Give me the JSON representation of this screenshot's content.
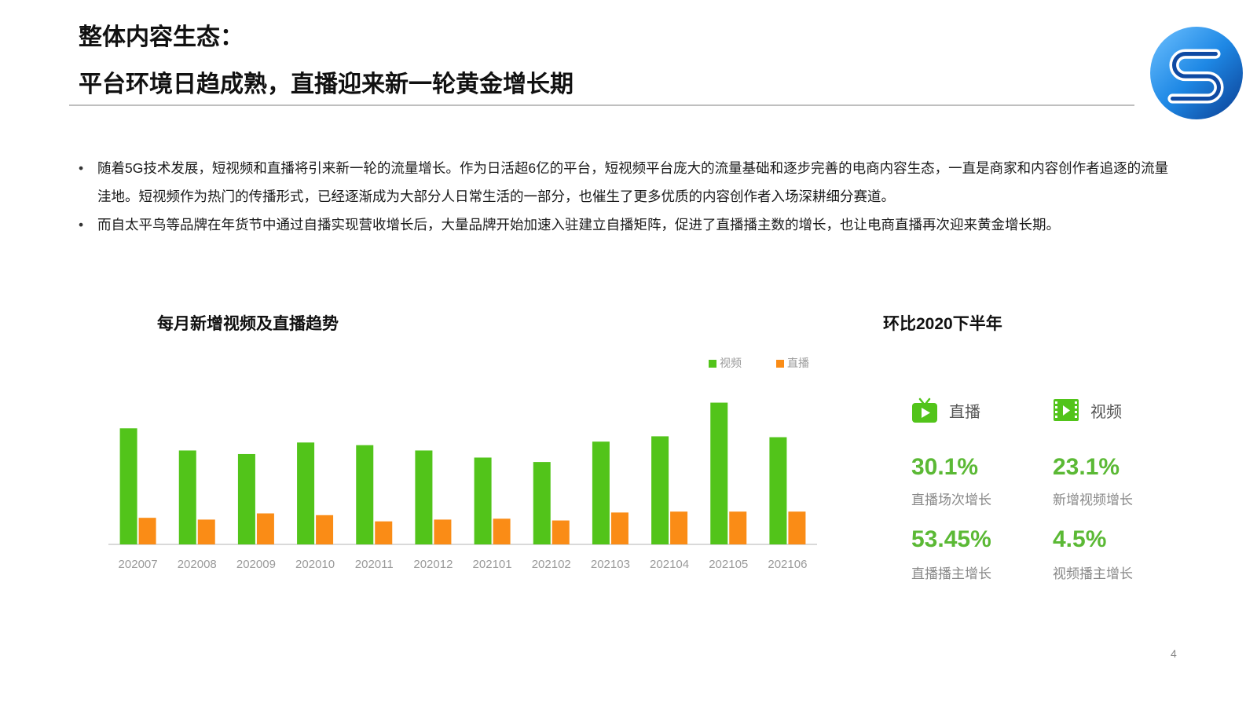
{
  "header": {
    "title_line1": "整体内容生态：",
    "title_line2": "平台环境日趋成熟，直播迎来新一轮黄金增长期"
  },
  "bullets": [
    "随着5G技术发展，短视频和直播将引来新一轮的流量增长。作为日活超6亿的平台，短视频平台庞大的流量基础和逐步完善的电商内容生态，一直是商家和内容创作者追逐的流量洼地。短视频作为热门的传播形式，已经逐渐成为大部分人日常生活的一部分，也催生了更多优质的内容创作者入场深耕细分赛道。",
    "而自太平鸟等品牌在年货节中通过自播实现营收增长后，大量品牌开始加速入驻建立自播矩阵，促进了直播播主数的增长，也让电商直播再次迎来黄金增长期。"
  ],
  "chart_data": {
    "type": "bar",
    "title": "每月新增视频及直播趋势",
    "categories": [
      "202007",
      "202008",
      "202009",
      "202010",
      "202011",
      "202012",
      "202101",
      "202102",
      "202103",
      "202104",
      "202105",
      "202106"
    ],
    "series": [
      {
        "name": "视频",
        "color": "#52c41a",
        "values": [
          131,
          106,
          102,
          115,
          112,
          106,
          98,
          93,
          116,
          122,
          160,
          121
        ]
      },
      {
        "name": "直播",
        "color": "#fa8c16",
        "values": [
          30,
          28,
          35,
          33,
          26,
          28,
          29,
          27,
          36,
          37,
          37,
          37
        ]
      }
    ],
    "ylim": [
      0,
      180
    ],
    "legend": "top-right",
    "grid": false
  },
  "side_panel": {
    "title": "环比2020下半年",
    "headers": [
      {
        "label": "直播",
        "icon": "tv-play-icon",
        "color": "#52c41a"
      },
      {
        "label": "视频",
        "icon": "film-icon",
        "color": "#52c41a"
      }
    ],
    "stats": [
      {
        "value": "30.1%",
        "label": "直播场次增长"
      },
      {
        "value": "23.1%",
        "label": "新增视频增长"
      },
      {
        "value": "53.45%",
        "label": "直播播主增长"
      },
      {
        "value": "4.5%",
        "label": "视频播主增长"
      }
    ]
  },
  "page_number": "4"
}
